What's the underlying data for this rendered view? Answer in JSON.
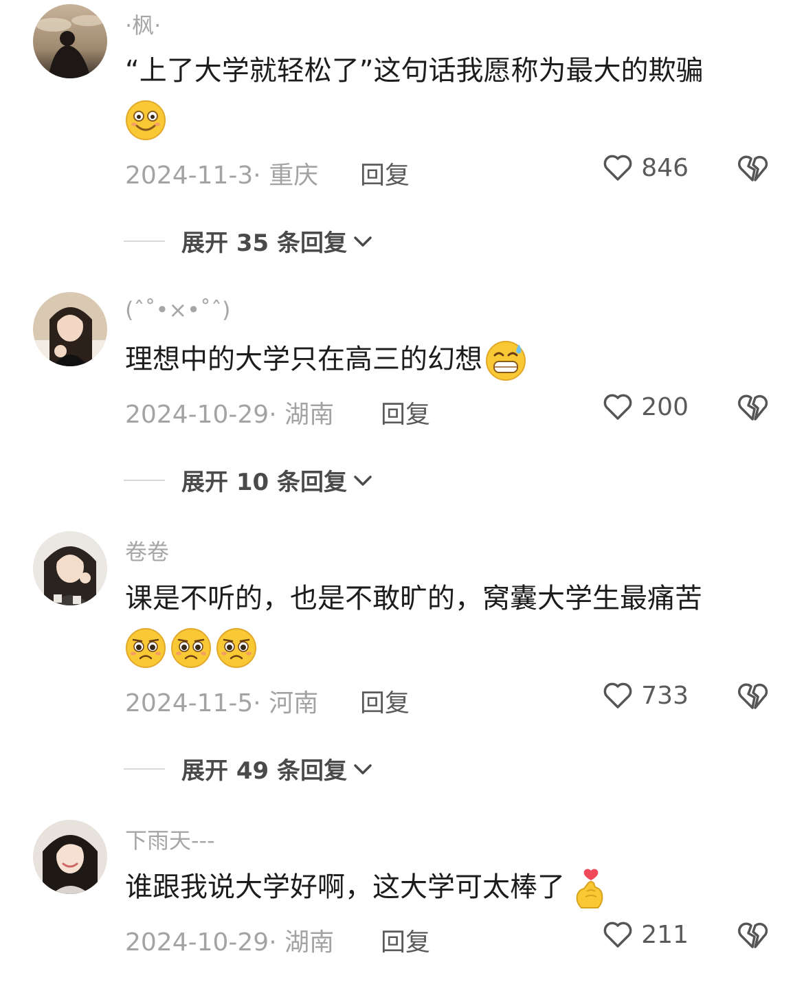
{
  "comments": [
    {
      "username": "·枫·",
      "text": "“上了大学就轻松了”这句话我愿称为最大的欺骗",
      "emojis": [
        "smile-emoji"
      ],
      "date_location": "2024-11-3· 重庆",
      "reply_label": "回复",
      "likes": "846",
      "expand_label": "展开 35 条回复"
    },
    {
      "username": "(ˆ˚•×•˚ˆ)",
      "text": "理想中的大学只在高三的幻想",
      "emojis": [
        "sweat-grin-emoji"
      ],
      "date_location": "2024-10-29· 湖南",
      "reply_label": "回复",
      "likes": "200",
      "expand_label": "展开 10 条回复"
    },
    {
      "username": "卷卷",
      "text": "课是不听的，也是不敢旷的，窝囊大学生最痛苦",
      "emojis": [
        "pleading-emoji",
        "pleading-emoji",
        "pleading-emoji"
      ],
      "date_location": "2024-11-5· 河南",
      "reply_label": "回复",
      "likes": "733",
      "expand_label": "展开 49 条回复"
    },
    {
      "username": "下雨天---",
      "text": "谁跟我说大学好啊，这大学可太棒了",
      "emojis": [
        "finger-heart-emoji"
      ],
      "date_location": "2024-10-29· 湖南",
      "reply_label": "回复",
      "likes": "211"
    }
  ],
  "colors": {
    "text": "#1c1c1c",
    "secondary": "#a3a3a3",
    "action": "#5a5a5a",
    "emoji_yellow": "#f8c935"
  }
}
